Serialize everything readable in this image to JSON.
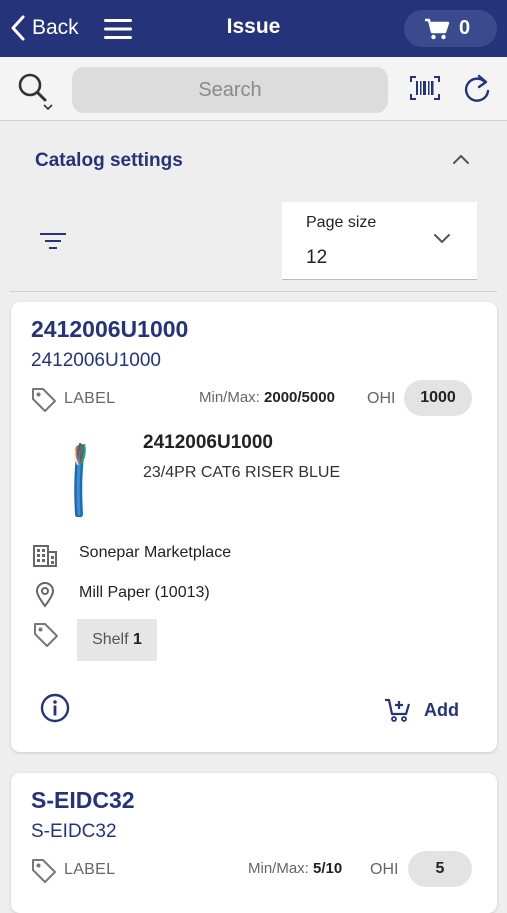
{
  "header": {
    "back_label": "Back",
    "title": "Issue",
    "cart_count": "0"
  },
  "search": {
    "placeholder": "Search"
  },
  "catalog": {
    "title": "Catalog settings",
    "page_size_label": "Page size",
    "page_size_value": "12"
  },
  "items": [
    {
      "code": "2412006U1000",
      "sub_code": "2412006U1000",
      "label": "LABEL",
      "minmax_label": "Min/Max:",
      "minmax_value": "2000/5000",
      "ohi_label": "OHI",
      "ohi_value": "1000",
      "name": "2412006U1000",
      "description": "23/4PR CAT6 RISER BLUE",
      "vendor": "Sonepar Marketplace",
      "location": "Mill Paper (10013)",
      "shelf_label": "Shelf",
      "shelf_value": "1",
      "add_label": "Add"
    },
    {
      "code": "S-EIDC32",
      "sub_code": "S-EIDC32",
      "label": "LABEL",
      "minmax_label": "Min/Max:",
      "minmax_value": "5/10",
      "ohi_label": "OHI",
      "ohi_value": "5"
    }
  ],
  "colors": {
    "brand": "#25347a",
    "pill": "#3a4a8d",
    "background": "#eeeeee"
  }
}
